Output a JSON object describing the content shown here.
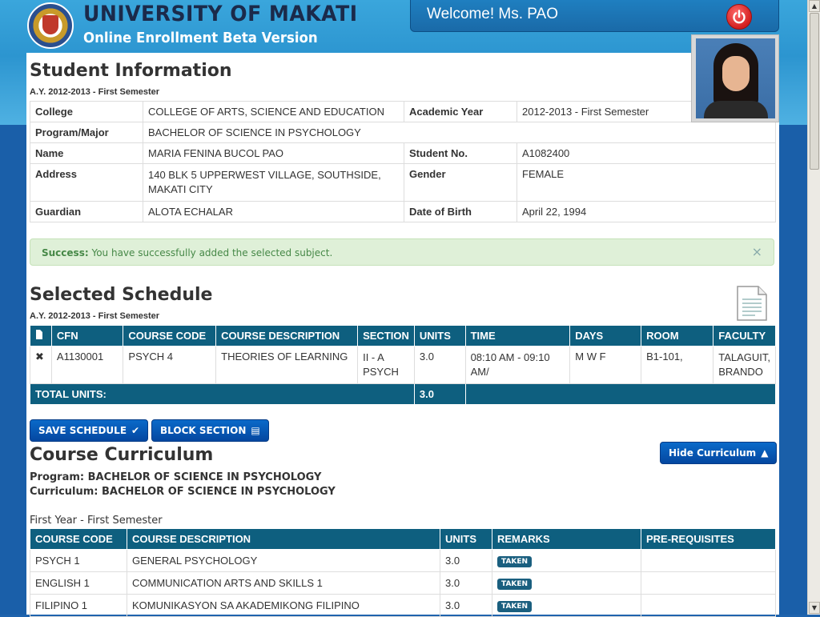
{
  "header": {
    "university": "UNIVERSITY OF MAKATI",
    "subtitle": "Online Enrollment Beta Version",
    "welcome": "Welcome! Ms. PAO"
  },
  "student_info": {
    "title": "Student Information",
    "ay": "A.Y. 2012-2013 - First Semester",
    "college_label": "College",
    "college": "COLLEGE OF ARTS, SCIENCE AND EDUCATION",
    "academic_year_label": "Academic Year",
    "academic_year": "2012-2013 - First Semester",
    "program_label": "Program/Major",
    "program": "BACHELOR OF SCIENCE IN PSYCHOLOGY",
    "name_label": "Name",
    "name": "MARIA FENINA BUCOL PAO",
    "student_no_label": "Student No.",
    "student_no": "A1082400",
    "address_label": "Address",
    "address": "140 BLK 5 UPPERWEST VILLAGE, SOUTHSIDE, MAKATI CITY",
    "gender_label": "Gender",
    "gender": "FEMALE",
    "guardian_label": "Guardian",
    "guardian": "ALOTA ECHALAR",
    "dob_label": "Date of Birth",
    "dob": "April 22, 1994"
  },
  "alert": {
    "strong": "Success:",
    "message": "You have successfully added the selected subject.",
    "close": "×"
  },
  "schedule": {
    "title": "Selected Schedule",
    "ay": "A.Y. 2012-2013 - First Semester",
    "columns": [
      "CFN",
      "COURSE CODE",
      "COURSE DESCRIPTION",
      "SECTION",
      "UNITS",
      "TIME",
      "DAYS",
      "ROOM",
      "FACULTY"
    ],
    "rows": [
      {
        "remove": "✖",
        "cfn": "A1130001",
        "code": "PSYCH 4",
        "description": "THEORIES OF LEARNING",
        "section": "II - A PSYCH",
        "units": "3.0",
        "time": "08:10 AM - 09:10 AM/",
        "days": "M W F",
        "room": "B1-101,",
        "faculty": "TALAGUIT, BRANDO"
      }
    ],
    "total_label": "TOTAL UNITS:",
    "total_units": "3.0"
  },
  "buttons": {
    "save": "SAVE SCHEDULE",
    "block": "BLOCK SECTION",
    "hide_curriculum": "Hide Curriculum"
  },
  "curriculum": {
    "title": "Course Curriculum",
    "program_line": "Program: BACHELOR OF SCIENCE IN PSYCHOLOGY",
    "curriculum_line": "Curriculum: BACHELOR OF SCIENCE IN PSYCHOLOGY",
    "year_heading": "First Year - First Semester",
    "columns": [
      "COURSE CODE",
      "COURSE DESCRIPTION",
      "UNITS",
      "REMARKS",
      "PRE-REQUISITES"
    ],
    "rows": [
      {
        "code": "PSYCH 1",
        "description": "GENERAL PSYCHOLOGY",
        "units": "3.0",
        "remarks": "TAKEN",
        "prereq": ""
      },
      {
        "code": "ENGLISH 1",
        "description": "COMMUNICATION ARTS AND SKILLS 1",
        "units": "3.0",
        "remarks": "TAKEN",
        "prereq": ""
      },
      {
        "code": "FILIPINO 1",
        "description": "KOMUNIKASYON SA AKADEMIKONG FILIPINO",
        "units": "3.0",
        "remarks": "TAKEN",
        "prereq": ""
      }
    ]
  }
}
